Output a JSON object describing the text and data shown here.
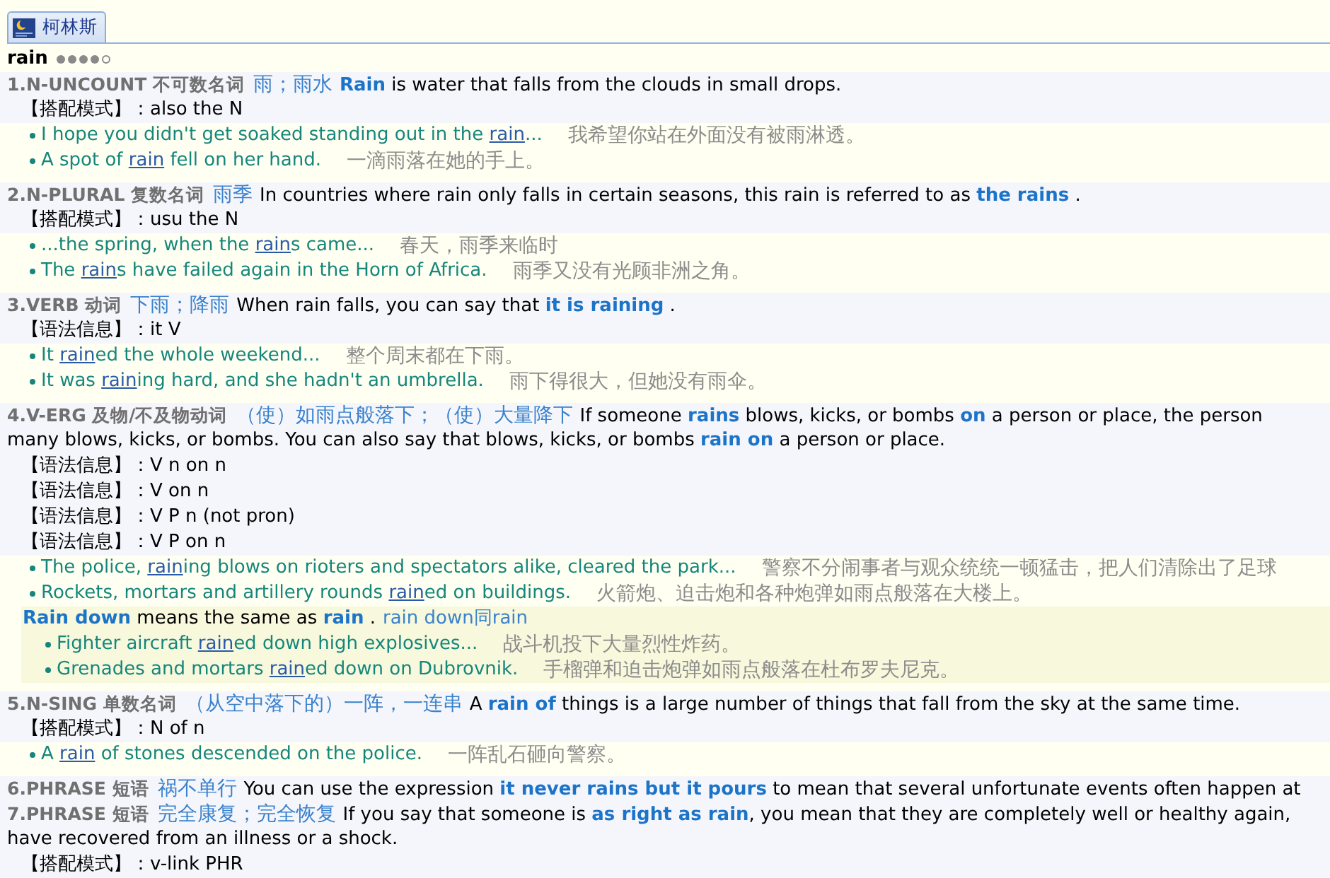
{
  "tabs": [
    {
      "label": "柯林斯",
      "selected": true
    }
  ],
  "headword": {
    "word": "rain",
    "stars": 4
  },
  "senses": [
    {
      "label": "1.N-UNCOUNT 不可数名词",
      "translation": "雨；雨水",
      "definition_lines": [
        "**Rain** is water that falls from the clouds in small drops."
      ],
      "grammar": [
        "【搭配模式】：also the N"
      ],
      "examples": [
        {
          "before": "I hope you didn't get soaked standing out in the ",
          "link": "rain",
          "after": "...",
          "translation": "我希望你站在外面没有被雨淋透。"
        },
        {
          "before": "A spot of ",
          "link": "rain",
          "after": " fell on her hand.",
          "translation": "一滴雨落在她的手上。"
        }
      ]
    },
    {
      "label": "2.N-PLURAL 复数名词",
      "translation": "雨季",
      "definition_lines": [
        "In countries where rain only falls in certain seasons, this rain is referred to as **the rains** ."
      ],
      "grammar": [
        "【搭配模式】：usu the N"
      ],
      "examples": [
        {
          "before": "...the spring, when the ",
          "link": "rain",
          "after": "s came...",
          "translation": "春天，雨季来临时"
        },
        {
          "before": "The ",
          "link": "rain",
          "after": "s have failed again in the Horn of Africa.",
          "translation": "雨季又没有光顾非洲之角。"
        }
      ]
    },
    {
      "label": "3.VERB 动词",
      "translation": "下雨；降雨",
      "definition_lines": [
        "When rain falls, you can say that **it is raining** ."
      ],
      "grammar": [
        "【语法信息】：it V"
      ],
      "examples": [
        {
          "before": "It ",
          "link": "rain",
          "after": "ed the whole weekend...",
          "translation": "整个周末都在下雨。"
        },
        {
          "before": "It was ",
          "link": "rain",
          "after": "ing hard, and she hadn't an umbrella.",
          "translation": "雨下得很大，但她没有雨伞。"
        }
      ]
    },
    {
      "label": "4.V-ERG 及物/不及物动词",
      "translation": "（使）如雨点般落下；（使）大量降下",
      "definition_lines": [
        "If someone **rains** blows, kicks, or bombs **on** a person or place, the person",
        "many blows, kicks, or bombs. You can also say that blows, kicks, or bombs **rain on** a person or place."
      ],
      "grammar": [
        "【语法信息】：V n on n",
        "【语法信息】：V on n",
        "【语法信息】：V P n (not pron)",
        "【语法信息】：V P on n"
      ],
      "examples": [
        {
          "before": "The police, ",
          "link": "rain",
          "after": "ing blows on rioters and spectators alike, cleared the park...",
          "translation": "警察不分闹事者与观众统统一顿猛击，把人们清除出了足球"
        },
        {
          "before": "Rockets, mortars and artillery rounds ",
          "link": "rain",
          "after": "ed on buildings.",
          "translation": "火箭炮、迫击炮和各种炮弹如雨点般落在大楼上。"
        }
      ],
      "phrases": [
        {
          "definition": "**Rain down** means the same as **rain** .",
          "translation": "rain down同rain",
          "examples": [
            {
              "before": "Fighter aircraft ",
              "link": "rain",
              "after": "ed down high explosives...",
              "translation": "战斗机投下大量烈性炸药。"
            },
            {
              "before": "Grenades and mortars ",
              "link": "rain",
              "after": "ed down on Dubrovnik.",
              "translation": "手榴弹和迫击炮弹如雨点般落在杜布罗夫尼克。"
            }
          ]
        }
      ]
    },
    {
      "label": "5.N-SING 单数名词",
      "translation": "（从空中落下的）一阵，一连串",
      "definition_lines": [
        "A **rain of** things is a large number of things that fall from the sky at the same time."
      ],
      "grammar": [
        "【搭配模式】：N of n"
      ],
      "examples": [
        {
          "before": "A ",
          "link": "rain",
          "after": " of stones descended on the police.",
          "translation": "一阵乱石砸向警察。"
        }
      ]
    },
    {
      "label": "6.PHRASE 短语",
      "translation": "祸不单行",
      "definition_lines": [
        "You can use the expression **it never rains but it pours** to mean that several unfortunate events often happen at"
      ]
    },
    {
      "label": "7.PHRASE 短语",
      "translation": "完全康复；完全恢复",
      "definition_lines": [
        "If you say that someone is **as right as rain**, you mean that they are completely well or healthy again,",
        "have recovered from an illness or a shock."
      ],
      "grammar": [
        "【搭配模式】：v-link PHR"
      ]
    }
  ]
}
